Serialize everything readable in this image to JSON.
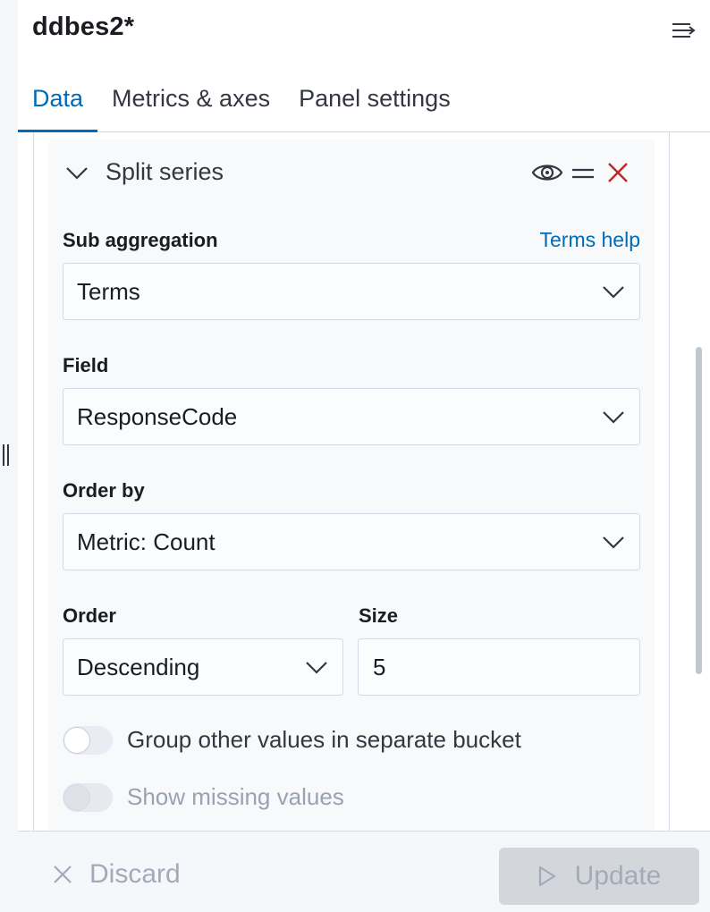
{
  "header": {
    "title": "ddbes2*",
    "tabs": [
      {
        "label": "Data",
        "active": true
      },
      {
        "label": "Metrics & axes",
        "active": false
      },
      {
        "label": "Panel settings",
        "active": false
      }
    ]
  },
  "panel": {
    "title": "Split series",
    "sub_aggregation": {
      "label": "Sub aggregation",
      "help_link": "Terms help",
      "value": "Terms"
    },
    "field": {
      "label": "Field",
      "value": "ResponseCode"
    },
    "order_by": {
      "label": "Order by",
      "value": "Metric: Count"
    },
    "order": {
      "label": "Order",
      "value": "Descending"
    },
    "size": {
      "label": "Size",
      "value": "5"
    },
    "group_other": {
      "label": "Group other values in separate bucket",
      "checked": false
    },
    "show_missing": {
      "label": "Show missing values",
      "checked": false,
      "disabled": true
    }
  },
  "footer": {
    "discard_label": "Discard",
    "update_label": "Update"
  },
  "colors": {
    "accent": "#006bb8",
    "danger": "#bd271e",
    "disabled_text": "#a2abba"
  },
  "icons": {
    "collapse": "menu-right-icon",
    "toggle": "chevron-down-icon",
    "visibility": "eye-icon",
    "drag": "drag-handle-icon",
    "remove": "close-icon",
    "discard": "close-icon",
    "update": "play-icon"
  }
}
